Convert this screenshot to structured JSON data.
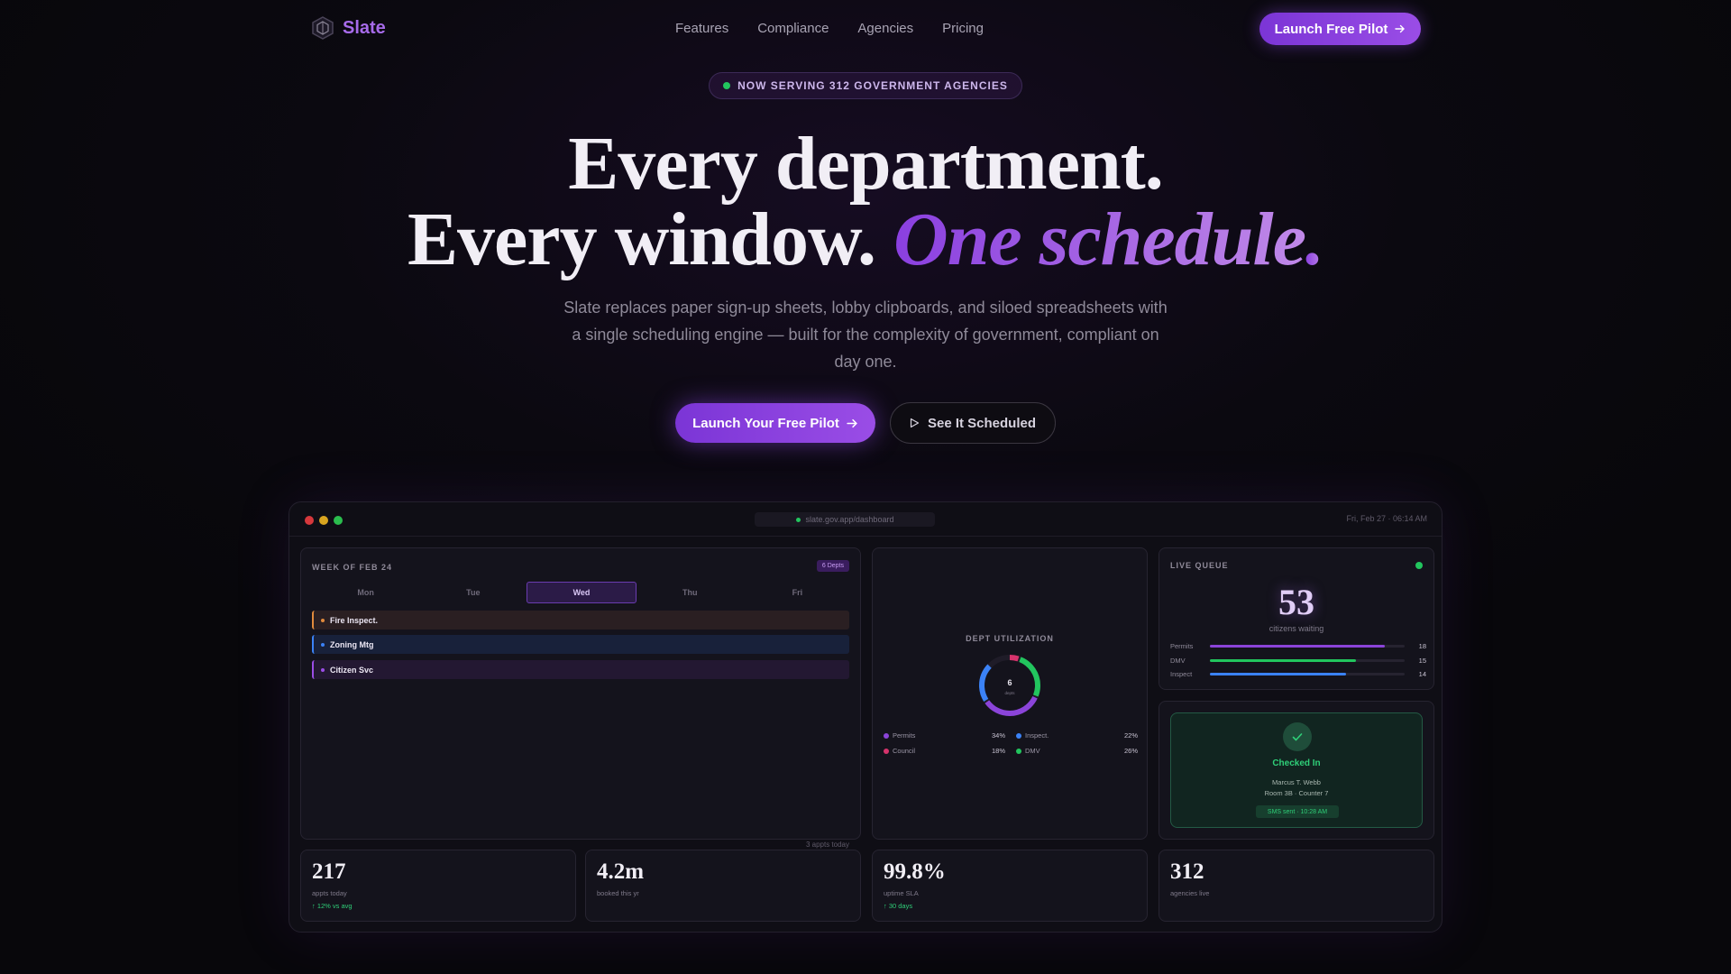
{
  "nav": {
    "brand": "Slate",
    "links": [
      "Features",
      "Compliance",
      "Agencies",
      "Pricing"
    ],
    "cta": "Launch Free Pilot"
  },
  "hero": {
    "badge": "NOW SERVING 312 GOVERNMENT AGENCIES",
    "line1": "Every department.",
    "line2_plain": "Every window. ",
    "line2_accent": "One schedule",
    "line2_period": ".",
    "subtitle": "Slate replaces paper sign-up sheets, lobby clipboards, and siloed spreadsheets with a single scheduling engine — built for the complexity of government, compliant on day one.",
    "primary_cta": "Launch Your Free Pilot",
    "secondary_cta": "See It Scheduled"
  },
  "dashboard": {
    "url": "slate.gov.app/dashboard",
    "datetime": "Fri, Feb 27 · 06:14 AM",
    "week": {
      "label": "WEEK OF FEB 24",
      "depts_badge": "6 Depts",
      "days": [
        "Mon",
        "Tue",
        "Wed",
        "Thu",
        "Fri"
      ],
      "active_day": "Wed",
      "appointments": [
        {
          "label": "Fire Inspect.",
          "color": "#e08a3c"
        },
        {
          "label": "Zoning Mtg",
          "color": "#3b82f6"
        },
        {
          "label": "Citizen Svc",
          "color": "#9b4de6"
        }
      ],
      "count": "3 appts today"
    },
    "utilization": {
      "label": "DEPT UTILIZATION",
      "center_value": "6",
      "center_label": "depts",
      "legend": [
        {
          "name": "Permits",
          "pct": "34%",
          "value": 34,
          "color": "#8b44d9"
        },
        {
          "name": "Inspect.",
          "pct": "22%",
          "value": 22,
          "color": "#3b82f6"
        },
        {
          "name": "Council",
          "pct": "18%",
          "value": 18,
          "color": "#d6336c"
        },
        {
          "name": "DMV",
          "pct": "26%",
          "value": 26,
          "color": "#22c55e"
        }
      ]
    },
    "queue": {
      "label": "LIVE QUEUE",
      "count": "53",
      "count_label": "citizens waiting",
      "rows": [
        {
          "name": "Permits",
          "value": "18",
          "fill": 0.9,
          "color": "#8b44d9"
        },
        {
          "name": "DMV",
          "value": "15",
          "fill": 0.75,
          "color": "#22c55e"
        },
        {
          "name": "Inspect",
          "value": "14",
          "fill": 0.7,
          "color": "#3b82f6"
        }
      ]
    },
    "checkin": {
      "title": "Checked In",
      "name": "Marcus T. Webb",
      "room": "Room 3B · Counter 7",
      "sms": "SMS sent · 10:28 AM"
    },
    "stats": [
      {
        "num": "217",
        "label": "appts today",
        "trend": "↑ 12% vs avg"
      },
      {
        "num": "4.2m",
        "label": "booked this yr",
        "trend": ""
      },
      {
        "num": "99.8%",
        "label": "uptime SLA",
        "trend": "↑ 30 days"
      },
      {
        "num": "312",
        "label": "agencies live",
        "trend": ""
      }
    ]
  }
}
